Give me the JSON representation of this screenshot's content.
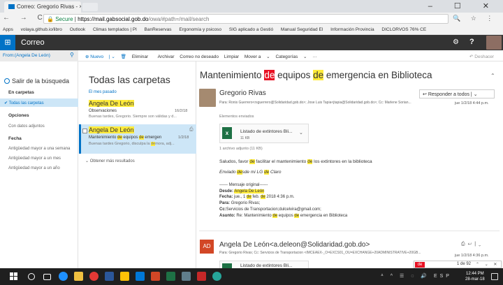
{
  "browser": {
    "tab_title": "Correo: Gregorio Rivas - ",
    "tab_close": "×",
    "nav_icons": "← → C ⌂",
    "window_controls": "–  ☐  ✕",
    "url_secure": "Secure",
    "url_host": "https://mail.gabsocial.gob.do",
    "url_path": "/owa/#path=/mail/search",
    "omni_icons": "🔍 ☆ ⋮",
    "bookmarks": [
      "Apps",
      "volaya.github.io/libro",
      "Outlook",
      "Climas templados | Pl",
      "BanReservas",
      "Ergonomía y psicoso",
      "SIG aplicado a Gestió",
      "Manual Seguridad El",
      "Información Provincia",
      "DICLORVOS 76% CE"
    ]
  },
  "owa": {
    "waffle_icon": "app-launcher-icon",
    "app_title": "Correo",
    "gear": "⚙",
    "help": "?"
  },
  "commandbar": {
    "search_value": "From:(Angela De León)",
    "search_icon": "⚲",
    "new_label": "Nuevo",
    "delete_label": "Eliminar",
    "archive_label": "Archivar",
    "junk_label": "Correo no deseado",
    "sweep_label": "Limpiar",
    "move_label": "Mover a",
    "categories_label": "Categorías",
    "more_label": "···",
    "undo_label": "Deshacer"
  },
  "leftpane": {
    "exit_search": "Salir de la búsqueda",
    "folders_heading": "En carpetas",
    "all_folders": "Todas las carpetas",
    "options_heading": "Opciones",
    "with_attachments": "Con datos adjuntos",
    "date_heading": "Fecha",
    "date_options": [
      "Antigüedad mayor a una semana",
      "Antigüedad mayor a un mes",
      "Antigüedad mayor a un año"
    ]
  },
  "midpane": {
    "title": "Todas las carpetas",
    "group_label": "El mes pasado",
    "messages": [
      {
        "from": "Angela De León",
        "subject": "Observaciones",
        "preview": "Buenas tardes, Gregorio. Siempre son válidas y d...",
        "date": "16/2/18"
      },
      {
        "from": "Angela De León",
        "subject_pre": "Mantenimiento ",
        "subject_hl1": "de",
        "subject_mid": " equipos ",
        "subject_hl2": "de",
        "subject_post": " emergen",
        "preview_pre": "Buenas tardes Gregorio, disculpa la ",
        "preview_hl": "de",
        "preview_post": "mora, adj...",
        "date": "1/2/18"
      }
    ],
    "more_results": "Obtener más resultados"
  },
  "reading": {
    "subject_pre": "Mantenimiento ",
    "subject_hl1": "de",
    "subject_mid": " equipos ",
    "subject_hl2": "de",
    "subject_post": " emergencia en Biblioteca",
    "sender1": "Gregorio Rivas",
    "to1": "Para: Ronis Guerrero<rsguerrero@Solidaridad.gob.do>; Jose Luis Tapia<jtapia@Solidaridad.gob.do>; Cc: Marlene Sorian...",
    "reply_all": "Responder a todos",
    "date1": "jue 1/2/18 4:44 p.m.",
    "sent_items": "Elementos enviados",
    "attachment_name": "Listado de extintores Bli...",
    "attachment_size": "11 KB",
    "attachment_count": "1 archivo adjunto (11 KB)",
    "body_line1_a": "Saludos, favor ",
    "body_line1_hl": "de",
    "body_line1_b": " facilitar el mantenimiento ",
    "body_line1_hl2": "de",
    "body_line1_c": " los extintores en la biblioteca",
    "body_line2_a": "Enviado ",
    "body_line2_hl": "de",
    "body_line2_b": "sde mi LG ",
    "body_line2_hl2": "de",
    "body_line2_c": " Claro",
    "orig_header": "------ Mensaje original------",
    "orig_from_label": "Desde:",
    "orig_from": "Angela De León",
    "orig_date_label": "Fecha:",
    "orig_date_a": "jue., 1 ",
    "orig_date_hl": "de",
    "orig_date_b": " feb. ",
    "orig_date_c": " 2018 4:36 p.m.",
    "orig_to_label": "Para:",
    "orig_to": "Gregorio Rivas;",
    "orig_cc_label": "Cc:",
    "orig_cc": "Servicios de Transportacion;dulcelvira@gmail.com;",
    "orig_subject_label": "Asunto:",
    "orig_subject_a": "Re: Mantenimiento ",
    "orig_subject_b": " equipos ",
    "orig_subject_c": " emergencia en Biblioteca",
    "ad_initials": "AD",
    "sender2": "Angela De León<a.deleon@Solidaridad.gob.do>",
    "to2": "Para: Gregorio Rivas; Cc: Servicios de Transportacion <IMCEAEX-_O=EXCS01_OU=EXCHANGE+20ADMINISTRATIVE+20GB...",
    "date2": "jue 1/2/18 4:36 p.m.",
    "attachment2_name": "Listado de extintores Bli..."
  },
  "findbar": {
    "term": "de",
    "count": "1 de 92",
    "arrows": "⌃ ⌄ ✕"
  },
  "taskbar": {
    "tray_icons": "ᐞ ^ ☰ ◌ 🔊 ESP",
    "time": "12:44 PM",
    "date": "28-mar-18"
  },
  "colors": {
    "accent": "#0072c6",
    "owa_header": "#333333",
    "highlight": "#ffeb3b",
    "find_highlight": "#e81123",
    "excel": "#1e7145",
    "ad_badge": "#d24726"
  }
}
